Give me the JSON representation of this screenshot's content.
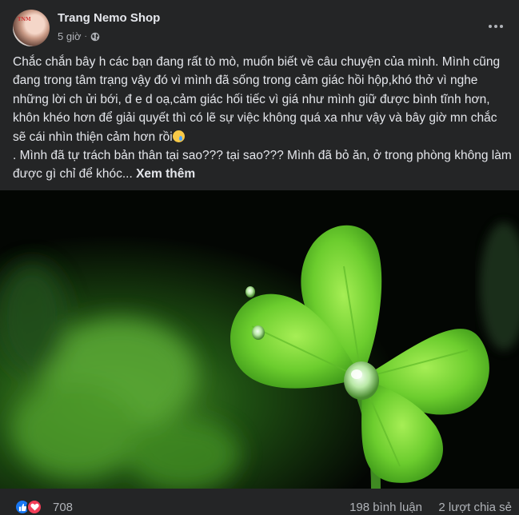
{
  "post": {
    "author": "Trang Nemo Shop",
    "avatar_badge": "TNM",
    "time": "5 giờ",
    "separator": "·",
    "privacy_icon": "globe-icon",
    "text": "Chắc chắn bây h các bạn đang rất tò mò, muốn biết về câu chuyện của mình. Mình cũng đang trong tâm trạng vậy đó vì mình đã sống trong cảm giác hồi hộp,khó thở vì nghe những lời ch ửi bới, đ e d oạ,cảm giác hối tiếc vì giá như mình giữ được bình tĩnh hơn, khôn khéo hơn để giải quyết thì có lẽ sự việc không quá xa như vậy và bây giờ mn chắc sẽ cái nhìn thiện cảm hơn rồi",
    "text_line2": ". Mình đã tự trách bản thân tại sao??? tại sao??? Mình đã bỏ ăn, ở trong phòng không làm được gì chỉ để khóc...",
    "see_more": "Xem thêm",
    "emoji": "sad-tear-emoji",
    "image": "four-leaf-clover-with-water-droplet"
  },
  "footer": {
    "reaction_icons": [
      "like-icon",
      "love-icon"
    ],
    "reactions": "708",
    "comments": "198 bình luận",
    "shares": "2 lượt chia sẻ"
  },
  "colors": {
    "background": "#242526",
    "text_primary": "#e4e6eb",
    "text_secondary": "#b0b3b8",
    "like_blue": "#1877f2",
    "love_red": "#f33e58",
    "clover_green": "#7fd43a"
  }
}
